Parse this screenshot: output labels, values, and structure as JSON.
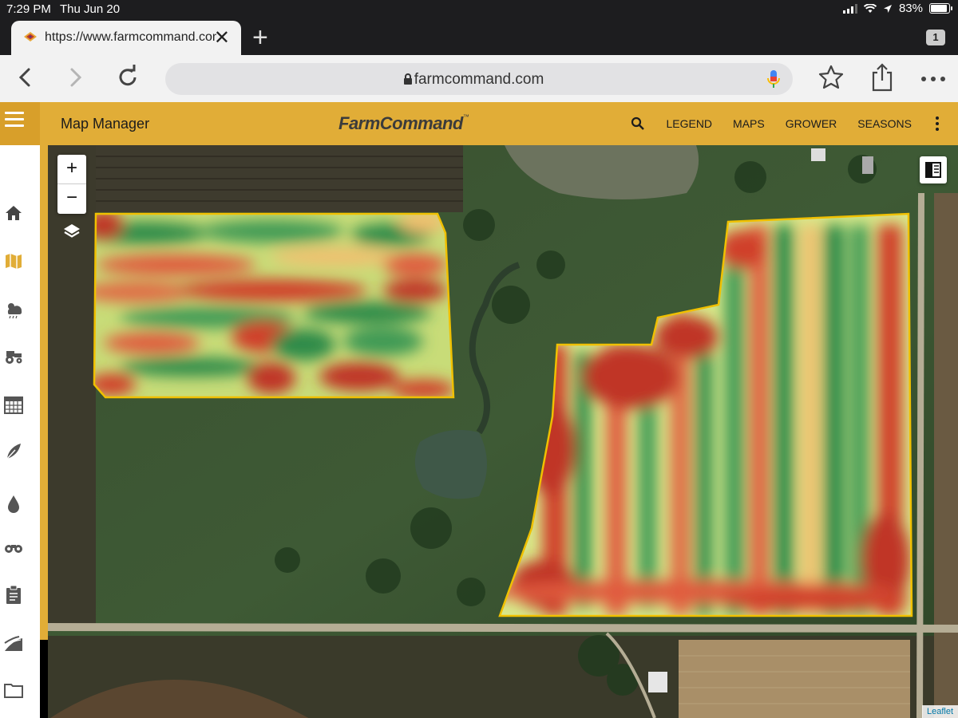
{
  "status": {
    "time": "7:29 PM",
    "date": "Thu Jun 20",
    "battery": "83%"
  },
  "browser": {
    "tab_title": "https://www.farmcommand.com",
    "tab_count": "1",
    "url": "farmcommand.com",
    "icons": [
      "back-icon",
      "forward-icon",
      "reload-icon",
      "lock-icon",
      "mic-icon",
      "star-icon",
      "share-icon",
      "more-icon"
    ]
  },
  "app": {
    "title": "Map Manager",
    "brand": "FarmCommand",
    "brand_tm": "™",
    "nav": [
      "LEGEND",
      "MAPS",
      "GROWER",
      "SEASONS"
    ]
  },
  "sidebar": {
    "items": [
      "home-icon",
      "map-icon",
      "weather-icon",
      "tractor-icon",
      "calendar-icon",
      "crop-icon",
      "water-drop-icon",
      "binoculars-icon",
      "clipboard-icon",
      "field-icon",
      "folder-icon"
    ]
  },
  "map": {
    "zoom_in": "+",
    "zoom_out": "−",
    "attribution": "Leaflet",
    "colors": {
      "low": "#c0392b",
      "mid": "#f6e58d",
      "high": "#2e8b4a",
      "boundary": "#f0c000"
    }
  }
}
